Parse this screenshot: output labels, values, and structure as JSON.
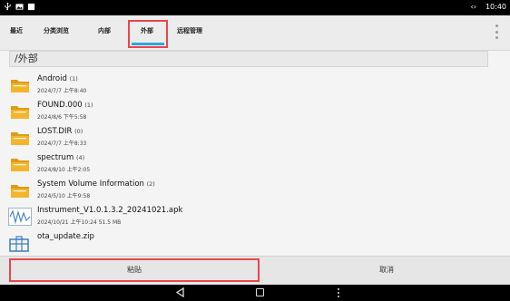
{
  "status_bar": {
    "time": "10:40",
    "icons": [
      "usb-icon",
      "image-icon",
      "square-icon",
      "code-brackets-icon"
    ]
  },
  "tabs": [
    {
      "label": "最近",
      "active": false
    },
    {
      "label": "分类浏览",
      "active": false
    },
    {
      "label": "内部",
      "active": false
    },
    {
      "label": "外部",
      "active": true
    },
    {
      "label": "远程管理",
      "active": false
    }
  ],
  "path": "/外部",
  "files": [
    {
      "name": "Android",
      "count": "(1)",
      "meta": "2024/7/7 上午8:40",
      "icon": "folder-icon"
    },
    {
      "name": "FOUND.000",
      "count": "(1)",
      "meta": "2024/8/6 下午5:58",
      "icon": "folder-icon"
    },
    {
      "name": "LOST.DIR",
      "count": "(0)",
      "meta": "2024/7/7 上午8:33",
      "icon": "folder-icon"
    },
    {
      "name": "spectrum",
      "count": "(4)",
      "meta": "2024/8/10 上午2:05",
      "icon": "folder-icon"
    },
    {
      "name": "System Volume Information",
      "count": "(2)",
      "meta": "2024/5/10 上午9:58",
      "icon": "folder-icon"
    },
    {
      "name": "Instrument_V1.0.1.3.2_20241021.apk",
      "count": "",
      "meta": "2024/10/21 上午10:24   51.5 MB",
      "icon": "apk-waveform-icon"
    },
    {
      "name": "ota_update.zip",
      "count": "",
      "meta": "",
      "icon": "archive-icon"
    }
  ],
  "actions": {
    "paste_label": "粘贴",
    "cancel_label": "取消"
  },
  "colors": {
    "highlight": "#e8464d",
    "tab_indicator": "#2fa6e0",
    "folder": "#f3b52b"
  }
}
